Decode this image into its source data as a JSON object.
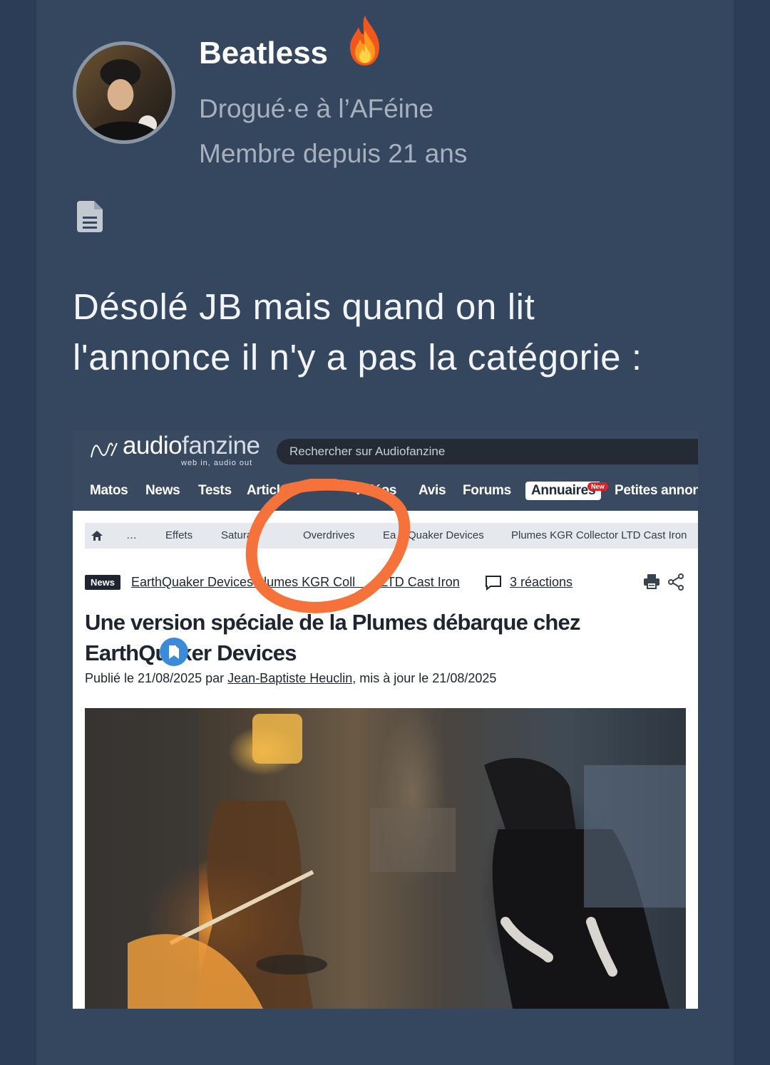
{
  "post": {
    "username": "Beatless",
    "rank": "Drogué·e à l’AFéine",
    "member_since": "Membre depuis 21 ans",
    "message": "Désolé JB mais quand on lit l'annonce il n'y a pas la catégorie :",
    "icons": [
      "flame-icon",
      "document-icon"
    ]
  },
  "screenshot": {
    "logo": {
      "part1": "audio",
      "part2": "fanzine",
      "tagline": "web in, audio out"
    },
    "search_placeholder": "Rechercher sur Audiofanzine",
    "nav": [
      "Matos",
      "News",
      "Tests",
      "Articles",
      "Vidéos",
      "Avis",
      "Forums",
      "Annuaires",
      "Petites annonce"
    ],
    "new_badge": "New",
    "breadcrumb": [
      "…",
      "Effets",
      "Saturati",
      "Overdrives",
      "Ea",
      "Quaker Devices",
      "Plumes KGR Collector LTD Cast Iron"
    ],
    "news_badge": "News",
    "tags_text": "EarthQuaker Devices   lumes KGR Coll     r LTD Cast Iron",
    "reactions": "3 réactions",
    "article_title": "Une version spéciale de la Plumes débarque chez EarthQuaker Devices",
    "published_prefix": "Publié le 21/08/2025 par ",
    "author": "Jean-Baptiste Heuclin",
    "published_suffix": ", mis à jour le 21/08/2025"
  },
  "colors": {
    "page_bg": "#2b3d57",
    "card_bg": "#34475f",
    "annotation": "#f5733a",
    "header_bg": "#394a60"
  }
}
